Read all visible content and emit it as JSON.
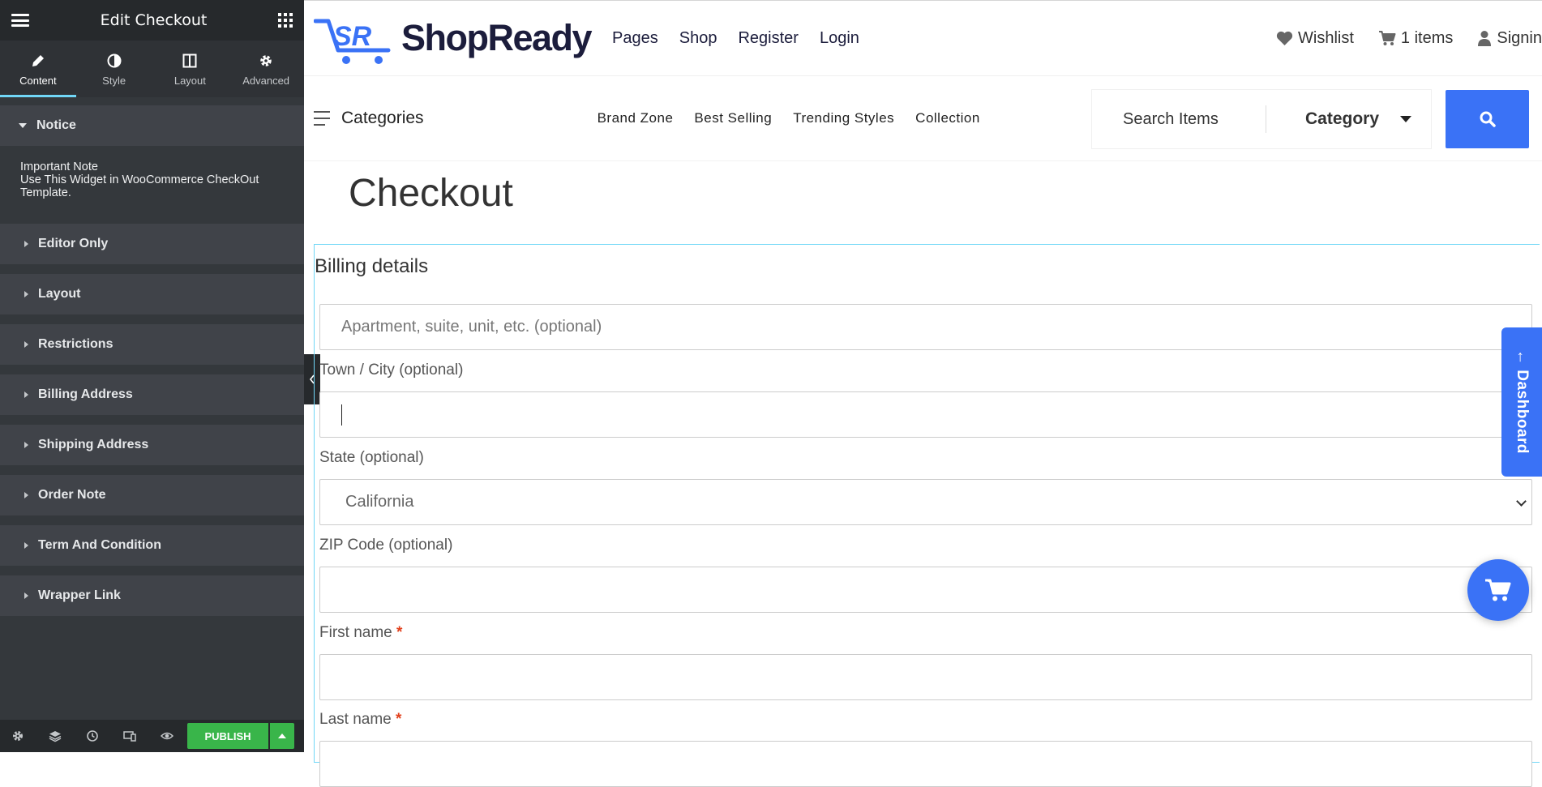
{
  "panel": {
    "title": "Edit Checkout",
    "tabs": [
      {
        "label": "Content",
        "icon": "pencil-icon"
      },
      {
        "label": "Style",
        "icon": "contrast-icon"
      },
      {
        "label": "Layout",
        "icon": "columns-icon"
      },
      {
        "label": "Advanced",
        "icon": "gear-icon"
      }
    ],
    "notice": {
      "title": "Notice",
      "line1": "Important Note",
      "line2": "Use This Widget in WooCommerce CheckOut Template."
    },
    "sections": [
      "Editor Only",
      "Layout",
      "Restrictions",
      "Billing Address",
      "Shipping Address",
      "Order Note",
      "Term And Condition",
      "Wrapper Link"
    ],
    "publish_label": "PUBLISH",
    "accent_color": "#71d7f7",
    "publish_color": "#39b54a"
  },
  "site": {
    "logo_text": "ShopReady",
    "nav": [
      "Pages",
      "Shop",
      "Register",
      "Login"
    ],
    "wishlist_label": "Wishlist",
    "cart_label": "1 items",
    "signin_label": "Signin",
    "categories_label": "Categories",
    "category_links": [
      "Brand Zone",
      "Best Selling",
      "Trending Styles",
      "Collection"
    ],
    "search_placeholder": "Search Items",
    "category_select": "Category",
    "brand_color": "#3a72f6",
    "page_title": "Checkout",
    "billing": {
      "title": "Billing details",
      "apartment_placeholder": "Apartment, suite, unit, etc. (optional)",
      "city_label": "Town / City (optional)",
      "state_label": "State (optional)",
      "state_value": "California",
      "zip_label": "ZIP Code (optional)",
      "first_name_label": "First name",
      "last_name_label": "Last name",
      "required_mark": "*"
    },
    "dashboard_label": "← Dashboard"
  }
}
